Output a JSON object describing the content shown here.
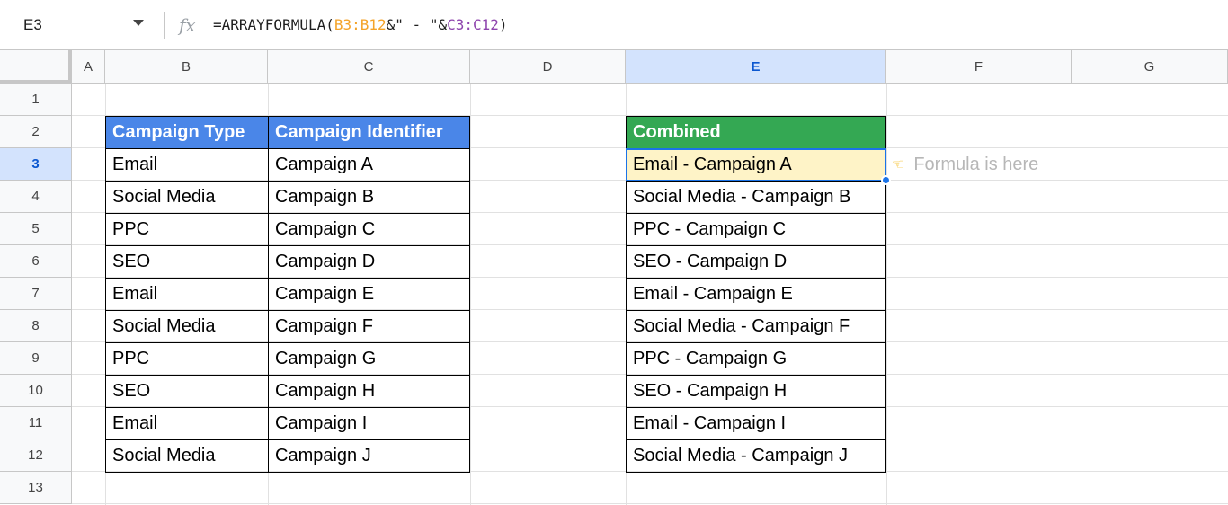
{
  "name_box": "E3",
  "formula": {
    "fx": "fx",
    "prefix": "=ARRAYFORMULA(",
    "ref1": "B3:B12",
    "mid": "&\" - \"&",
    "ref2": "C3:C12",
    "suffix": ")"
  },
  "columns": [
    "A",
    "B",
    "C",
    "D",
    "E",
    "F",
    "G"
  ],
  "rows": [
    "1",
    "2",
    "3",
    "4",
    "5",
    "6",
    "7",
    "8",
    "9",
    "10",
    "11",
    "12",
    "13"
  ],
  "table1": {
    "headers": [
      "Campaign Type",
      "Campaign Identifier"
    ],
    "rows": [
      [
        "Email",
        "Campaign A"
      ],
      [
        "Social Media",
        "Campaign B"
      ],
      [
        "PPC",
        "Campaign C"
      ],
      [
        "SEO",
        "Campaign D"
      ],
      [
        "Email",
        "Campaign E"
      ],
      [
        "Social Media",
        "Campaign F"
      ],
      [
        "PPC",
        "Campaign G"
      ],
      [
        "SEO",
        "Campaign H"
      ],
      [
        "Email",
        "Campaign I"
      ],
      [
        "Social Media",
        "Campaign J"
      ]
    ]
  },
  "combined": {
    "header": "Combined",
    "values": [
      "Email - Campaign A",
      "Social Media - Campaign B",
      "PPC - Campaign C",
      "SEO - Campaign D",
      "Email - Campaign E",
      "Social Media - Campaign F",
      "PPC - Campaign G",
      "SEO - Campaign H",
      "Email - Campaign I",
      "Social Media - Campaign J"
    ]
  },
  "note": {
    "icon": "pointing-hand-icon",
    "text": "Formula is here"
  },
  "colors": {
    "header_blue": "#4a86e8",
    "header_green": "#34a853",
    "selection": "#1a73e8",
    "active_fill": "#fef3c7"
  }
}
